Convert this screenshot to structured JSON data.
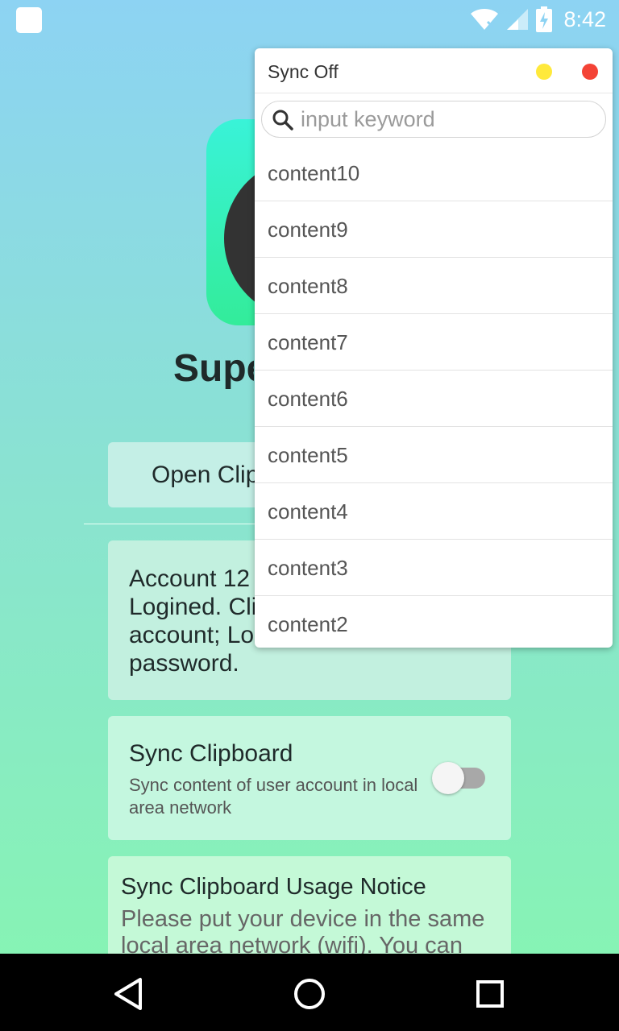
{
  "status_bar": {
    "time": "8:42",
    "icons": [
      "notification-square-icon",
      "wifi-icon",
      "signal-icon",
      "battery-charging-icon"
    ]
  },
  "app": {
    "title_visible": "Supe",
    "open_button_label": "Open Clip",
    "account_text": "Account 12… Logined. Cli… account; Lo… password.",
    "account_lines": [
      "Account 12",
      "Logined. Cli",
      "account; Lo",
      "password."
    ],
    "sync": {
      "title": "Sync Clipboard",
      "description": "Sync content of user account in local area network",
      "enabled": false
    },
    "notice": {
      "title": "Sync Clipboard Usage Notice",
      "body": "Please put your device in the same local area network (wifi). You can"
    }
  },
  "popup": {
    "title": "Sync Off",
    "search_placeholder": "input keyword",
    "search_value": "",
    "items": [
      "content10",
      "content9",
      "content8",
      "content7",
      "content6",
      "content5",
      "content4",
      "content3",
      "content2"
    ],
    "colors": {
      "minimize": "#ffe93b",
      "close": "#f44336"
    }
  },
  "nav": {
    "buttons": [
      "back-icon",
      "home-icon",
      "recents-icon"
    ]
  }
}
